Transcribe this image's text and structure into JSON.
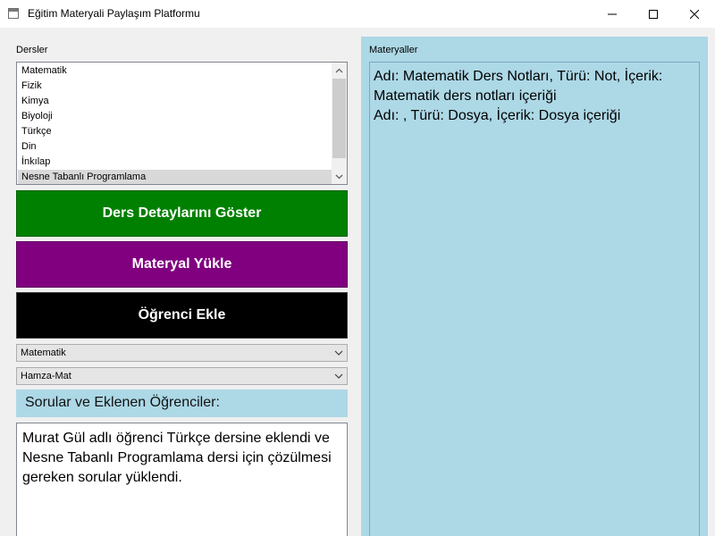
{
  "window": {
    "title": "Eğitim Materyali Paylaşım Platformu"
  },
  "left": {
    "courses_label": "Dersler",
    "courses": [
      "Matematik",
      "Fizik",
      "Kimya",
      "Biyoloji",
      "Türkçe",
      "Din",
      "İnkılap",
      "Nesne Tabanlı Programlama"
    ],
    "selected_course": "Nesne Tabanlı Programlama",
    "buttons": {
      "show_details": "Ders Detaylarını Göster",
      "upload_material": "Materyal Yükle",
      "add_student": "Öğrenci Ekle"
    },
    "colors": {
      "show_details": "#008000",
      "upload_material": "#800080",
      "add_student": "#000000"
    },
    "course_combo_value": "Matematik",
    "student_combo_value": "Hamza-Mat",
    "questions_label": "Sorular ve Eklenen Öğrenciler:",
    "questions_text": "Murat Gül adlı öğrenci Türkçe dersine eklendi ve Nesne Tabanlı Programlama dersi için çözülmesi gereken sorular yüklendi."
  },
  "right": {
    "materials_label": "Materyaller",
    "materials": [
      "Adı: Matematik Ders Notları, Türü: Not, İçerik: Matematik ders notları içeriği",
      "Adı: , Türü: Dosya, İçerik: Dosya içeriği"
    ],
    "panel_color": "#add8e6"
  }
}
